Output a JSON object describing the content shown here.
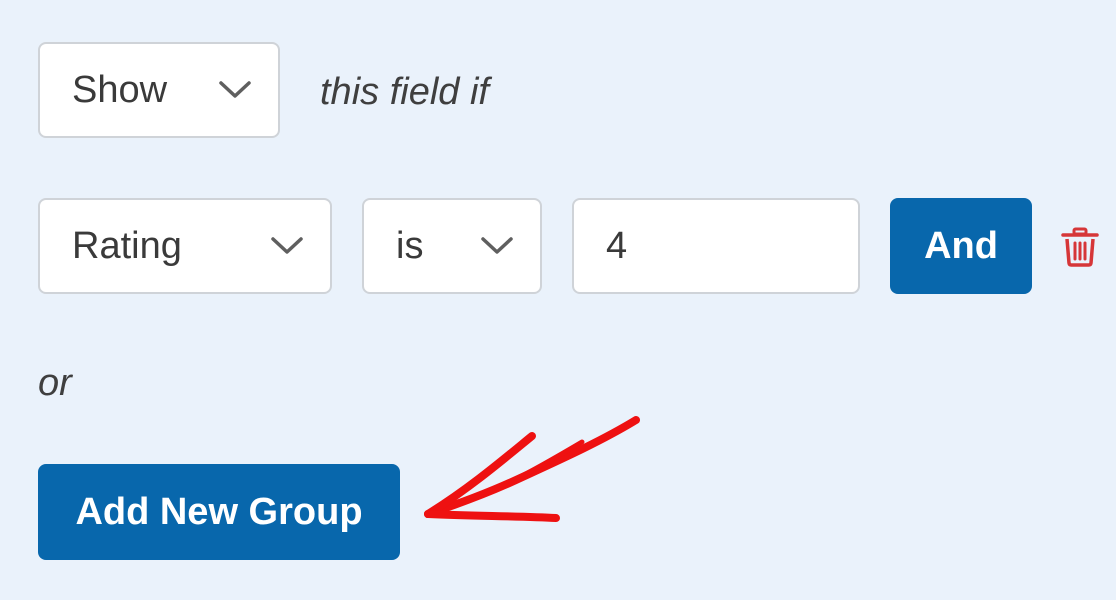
{
  "condition": {
    "action_value": "Show",
    "label": "this field if"
  },
  "rule": {
    "field_value": "Rating",
    "operator_value": "is",
    "compare_value": "4",
    "and_label": "And"
  },
  "or_label": "or",
  "add_group_label": "Add New Group",
  "icons": {
    "select_chevron": "chevron-down-icon",
    "delete": "trash-icon",
    "annotation": "red-arrow-annotation"
  },
  "colors": {
    "background": "#EAF2FB",
    "primary_button": "#0867AC",
    "delete_icon": "#D63638",
    "annotation_arrow": "#EE1111"
  }
}
